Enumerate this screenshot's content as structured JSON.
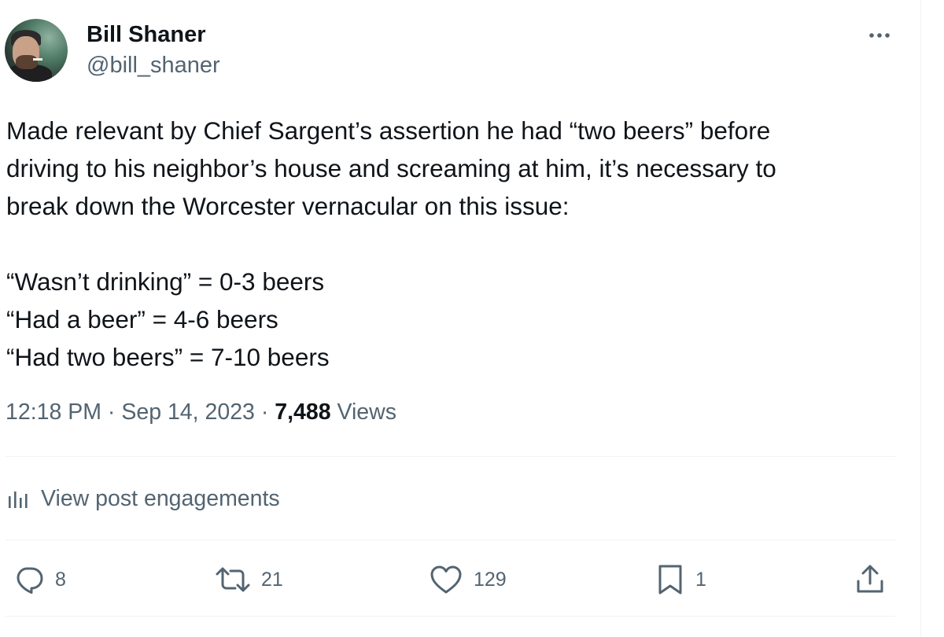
{
  "author": {
    "display_name": "Bill Shaner",
    "handle": "@bill_shaner",
    "avatar_icon": "profile-photo"
  },
  "post": {
    "lines": [
      "Made relevant by Chief Sargent’s assertion he had “two beers” before",
      "driving to his neighbor’s house and screaming at him, it’s necessary to",
      "break down the Worcester vernacular on this issue:"
    ],
    "list": [
      "“Wasn’t drinking” = 0-3 beers",
      "“Had a beer” = 4-6 beers",
      "“Had two beers” = 7-10 beers"
    ]
  },
  "meta": {
    "time": "12:18 PM",
    "separator": " · ",
    "date": "Sep 14, 2023",
    "views_count": "7,488",
    "views_label": " Views"
  },
  "engagements": {
    "label": "View post engagements",
    "icon": "analytics-icon"
  },
  "actions": {
    "replies": {
      "icon": "reply-icon",
      "count": "8"
    },
    "reposts": {
      "icon": "repost-icon",
      "count": "21"
    },
    "likes": {
      "icon": "like-icon",
      "count": "129"
    },
    "bookmarks": {
      "icon": "bookmark-icon",
      "count": "1"
    },
    "share": {
      "icon": "share-icon"
    }
  },
  "colors": {
    "text": "#0f1419",
    "secondary": "#536471",
    "divider": "#eff3f4"
  }
}
